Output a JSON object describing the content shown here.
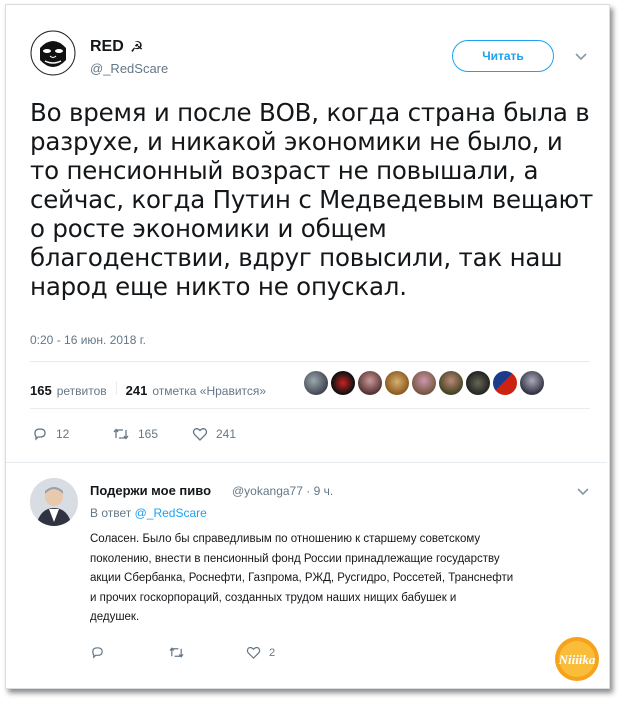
{
  "tweet": {
    "author_name": "RED",
    "author_flair": "☭",
    "author_handle": "@_RedScare",
    "follow_label": "Читать",
    "text_lines": [
      "Во время и после ВОВ, когда страна была в",
      "разрухе, и никакой экономики не было, и",
      "то пенсионный возраст не повышали, а",
      "сейчас, когда Путин с Медведевым вещают",
      "о росте экономики и общем",
      "благоденствии, вдруг повысили, так наш",
      "народ еще никто не опускал."
    ],
    "timestamp": "0:20 - 16 июн. 2018 г.",
    "retweets_count": "165",
    "retweets_label": "ретвитов",
    "likes_count": "241",
    "likes_label": "отметка «Нравится»",
    "actions": {
      "reply_count": "12",
      "retweet_count": "165",
      "like_count": "241"
    }
  },
  "reply": {
    "author_name": "Подержи мое пиво",
    "author_handle_time": "@yokanga77 · 9 ч.",
    "in_reply_prefix": "В ответ",
    "in_reply_handle": "@_RedScare",
    "text_lines": [
      "Соласен. Было бы справедливым по отношению к старшему советскому",
      "поколению, внести в пенсионный фонд России принадлежащие государству",
      "акции Сбербанка, Роснефти, Газпрома, РЖД, Русгидро, Россетей, Транснефти",
      "и прочих госкорпораций, созданных трудом наших нищих бабушек и",
      "дедушек."
    ],
    "actions": {
      "reply_count": "",
      "retweet_count": "",
      "like_count": "2"
    }
  },
  "watermark": {
    "text": "Niiiika"
  },
  "colors": {
    "accent": "#1da1f2",
    "muted": "#657786",
    "text": "#14171a",
    "divider": "#e6ecf0"
  }
}
